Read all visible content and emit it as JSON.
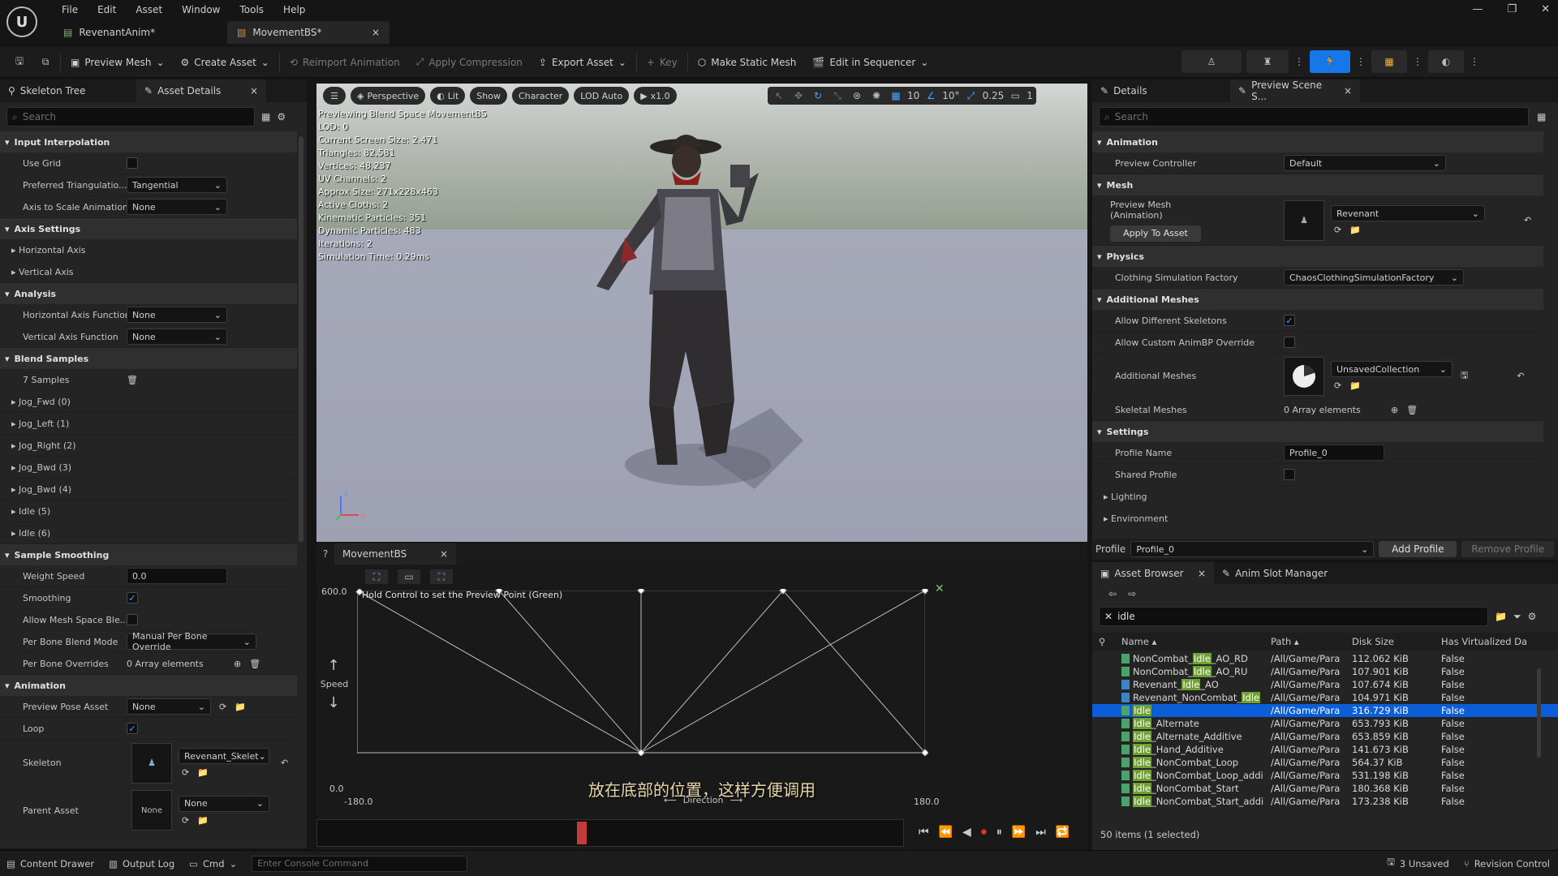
{
  "app": {
    "menu": [
      "File",
      "Edit",
      "Asset",
      "Window",
      "Tools",
      "Help"
    ],
    "tabs": [
      {
        "label": "RevenantAnim*"
      },
      {
        "label": "MovementBS*"
      }
    ]
  },
  "toolbar": {
    "preview_mesh": "Preview Mesh",
    "create_asset": "Create Asset",
    "reimport": "Reimport Animation",
    "apply_compression": "Apply Compression",
    "export_asset": "Export Asset",
    "key": "Key",
    "make_static_mesh": "Make Static Mesh",
    "edit_in_sequencer": "Edit in Sequencer"
  },
  "left": {
    "tab_skeleton": "Skeleton Tree",
    "tab_asset_details": "Asset Details",
    "search_placeholder": "Search",
    "rows": [
      {
        "t": "cat",
        "label": "Input Interpolation"
      },
      {
        "t": "check",
        "label": "Use Grid",
        "checked": false
      },
      {
        "t": "dd",
        "label": "Preferred Triangulatio...",
        "value": "Tangential"
      },
      {
        "t": "dd",
        "label": "Axis to Scale Animation",
        "value": "None"
      },
      {
        "t": "cat",
        "label": "Axis Settings"
      },
      {
        "t": "exp",
        "label": "Horizontal Axis"
      },
      {
        "t": "exp",
        "label": "Vertical Axis"
      },
      {
        "t": "cat",
        "label": "Analysis"
      },
      {
        "t": "dd",
        "label": "Horizontal Axis Functior",
        "value": "None"
      },
      {
        "t": "dd",
        "label": "Vertical Axis Function",
        "value": "None"
      },
      {
        "t": "cat",
        "label": "Blend Samples"
      },
      {
        "t": "trash",
        "label": "7 Samples"
      },
      {
        "t": "exp",
        "label": "Jog_Fwd (0)"
      },
      {
        "t": "exp",
        "label": "Jog_Left (1)"
      },
      {
        "t": "exp",
        "label": "Jog_Right (2)"
      },
      {
        "t": "exp",
        "label": "Jog_Bwd (3)"
      },
      {
        "t": "exp",
        "label": "Jog_Bwd (4)"
      },
      {
        "t": "exp",
        "label": "Idle (5)"
      },
      {
        "t": "exp",
        "label": "Idle (6)"
      },
      {
        "t": "cat",
        "label": "Sample Smoothing"
      },
      {
        "t": "field",
        "label": "Weight Speed",
        "value": "0.0"
      },
      {
        "t": "check",
        "label": "Smoothing",
        "checked": true
      },
      {
        "t": "check",
        "label": "Allow Mesh Space Ble...",
        "checked": false
      },
      {
        "t": "dd",
        "label": "Per Bone Blend Mode",
        "value": "Manual Per Bone Override"
      },
      {
        "t": "arr",
        "label": "Per Bone Overrides",
        "value": "0 Array elements"
      },
      {
        "t": "cat",
        "label": "Animation"
      },
      {
        "t": "asset",
        "label": "Preview Pose Asset",
        "value": "None"
      },
      {
        "t": "check",
        "label": "Loop",
        "checked": true
      }
    ],
    "skeleton_label": "Skeleton",
    "skeleton_value": "Revenant_Skelet",
    "parent_label": "Parent Asset",
    "parent_value": "None",
    "parent_thumb": "None"
  },
  "viewport": {
    "buttons": {
      "perspective": "Perspective",
      "lit": "Lit",
      "show": "Show",
      "character": "Character",
      "lod": "LOD Auto",
      "speed": "x1.0"
    },
    "grid": "10",
    "angle": "10°",
    "scale": "0.25",
    "cam": "1",
    "stats": [
      "Previewing Blend Space MovementBS",
      "LOD: 0",
      "Current Screen Size: 2.471",
      "Triangles: 82,581",
      "Vertices: 48,237",
      "UV Channels: 2",
      "Approx Size: 271x228x463",
      "Active Cloths: 2",
      "Kinematic Particles: 351",
      "Dynamic Particles: 483",
      "Iterations: 2",
      "Simulation Time: 0.29ms"
    ]
  },
  "blend": {
    "tab": "MovementBS",
    "hint": "Hold Control to set the Preview Point (Green)",
    "y_max": "600.0",
    "y_min": "0.0",
    "x_min": "-180.0",
    "x_max": "180.0",
    "y_axis": "Speed",
    "x_axis": "Direction",
    "subtitle": "放在底部的位置，这样方便调用"
  },
  "details": {
    "tab": "Details",
    "tab2": "Preview Scene S...",
    "search_placeholder": "Search",
    "cat_animation": "Animation",
    "preview_controller_label": "Preview Controller",
    "preview_controller": "Default",
    "cat_mesh": "Mesh",
    "preview_mesh_label": "Preview Mesh (Animation)",
    "preview_mesh": "Revenant",
    "apply_to_asset": "Apply To Asset",
    "cat_physics": "Physics",
    "cloth_label": "Clothing Simulation Factory",
    "cloth": "ChaosClothingSimulationFactory",
    "cat_additional": "Additional Meshes",
    "allow_diff_label": "Allow Different Skeletons",
    "allow_custom_label": "Allow Custom AnimBP Override",
    "add_meshes_label": "Additional Meshes",
    "add_meshes": "UnsavedCollection",
    "skel_meshes_label": "Skeletal Meshes",
    "skel_meshes": "0 Array elements",
    "cat_settings": "Settings",
    "profile_name_label": "Profile Name",
    "profile_name": "Profile_0",
    "shared_label": "Shared Profile",
    "lighting": "Lighting",
    "environment": "Environment",
    "profile_label": "Profile",
    "profile": "Profile_0",
    "add_profile": "Add Profile",
    "remove_profile": "Remove Profile"
  },
  "assets": {
    "tab": "Asset Browser",
    "tab2": "Anim Slot Manager",
    "filter": "idle",
    "col_name": "Name",
    "col_path": "Path",
    "col_size": "Disk Size",
    "col_virt": "Has Virtualized Da",
    "rows": [
      {
        "pre": "NonCombat_",
        "hl": "Idle",
        "post": "_AO_RD",
        "path": "/All/Game/Para",
        "size": "112.062 KiB",
        "virt": "False",
        "icon": "#4aa36b"
      },
      {
        "pre": "NonCombat_",
        "hl": "Idle",
        "post": "_AO_RU",
        "path": "/All/Game/Para",
        "size": "107.901 KiB",
        "virt": "False",
        "icon": "#4aa36b"
      },
      {
        "pre": "Revenant_",
        "hl": "Idle",
        "post": "_AO",
        "path": "/All/Game/Para",
        "size": "107.674 KiB",
        "virt": "False",
        "icon": "#3d84c6"
      },
      {
        "pre": "Revenant_NonCombat_",
        "hl": "Idle",
        "post": "",
        "path": "/All/Game/Para",
        "size": "104.971 KiB",
        "virt": "False",
        "icon": "#3d84c6"
      },
      {
        "pre": "",
        "hl": "Idle",
        "post": "",
        "path": "/All/Game/Para",
        "size": "316.729 KiB",
        "virt": "False",
        "icon": "#4aa36b",
        "sel": true
      },
      {
        "pre": "",
        "hl": "Idle",
        "post": "_Alternate",
        "path": "/All/Game/Para",
        "size": "653.793 KiB",
        "virt": "False",
        "icon": "#4aa36b"
      },
      {
        "pre": "",
        "hl": "Idle",
        "post": "_Alternate_Additive",
        "path": "/All/Game/Para",
        "size": "653.859 KiB",
        "virt": "False",
        "icon": "#4aa36b"
      },
      {
        "pre": "",
        "hl": "Idle",
        "post": "_Hand_Additive",
        "path": "/All/Game/Para",
        "size": "141.673 KiB",
        "virt": "False",
        "icon": "#4aa36b"
      },
      {
        "pre": "",
        "hl": "Idle",
        "post": "_NonCombat_Loop",
        "path": "/All/Game/Para",
        "size": "564.37 KiB",
        "virt": "False",
        "icon": "#4aa36b"
      },
      {
        "pre": "",
        "hl": "Idle",
        "post": "_NonCombat_Loop_addi",
        "path": "/All/Game/Para",
        "size": "531.198 KiB",
        "virt": "False",
        "icon": "#4aa36b"
      },
      {
        "pre": "",
        "hl": "Idle",
        "post": "_NonCombat_Start",
        "path": "/All/Game/Para",
        "size": "180.368 KiB",
        "virt": "False",
        "icon": "#4aa36b"
      },
      {
        "pre": "",
        "hl": "Idle",
        "post": "_NonCombat_Start_addi",
        "path": "/All/Game/Para",
        "size": "173.238 KiB",
        "virt": "False",
        "icon": "#4aa36b"
      }
    ],
    "footer": "50 items (1 selected)"
  },
  "status": {
    "content_drawer": "Content Drawer",
    "output_log": "Output Log",
    "cmd": "Cmd",
    "console_placeholder": "Enter Console Command",
    "unsaved": "3 Unsaved",
    "revision": "Revision Control"
  }
}
